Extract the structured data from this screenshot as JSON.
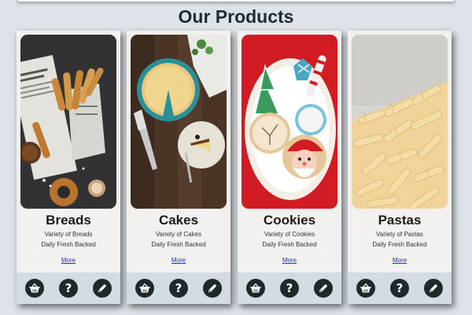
{
  "page": {
    "title": "Our Products"
  },
  "products": [
    {
      "name": "Breads",
      "line1": "Variety of Breads",
      "line2": "Daily Fresh Backed",
      "more_label": "More",
      "image": "churros-and-bread-photo",
      "actions": [
        "basket-icon",
        "help-icon",
        "edit-pencil-icon"
      ]
    },
    {
      "name": "Cakes",
      "line1": "Variety of Cakes",
      "line2": "Daily Fresh Backed",
      "more_label": "More",
      "image": "cheesecake-photo",
      "actions": [
        "basket-icon",
        "help-icon",
        "edit-pencil-icon"
      ]
    },
    {
      "name": "Cookies",
      "line1": "Variety of Cookies",
      "line2": "Daily Fresh Backed",
      "more_label": "More",
      "image": "christmas-cookies-photo",
      "actions": [
        "basket-icon",
        "help-icon",
        "edit-pencil-icon"
      ]
    },
    {
      "name": "Pastas",
      "line1": "Variety of Pastas",
      "line2": "Daily Fresh Backed",
      "more_label": "More",
      "image": "fusilli-pasta-photo",
      "actions": [
        "basket-icon",
        "help-icon",
        "edit-pencil-icon"
      ]
    }
  ],
  "icons": {
    "help_glyph": "?"
  },
  "colors": {
    "background": "#dde3e8",
    "card": "#f3f1ef",
    "footer": "#d5dce1",
    "icon_circle": "#1e2a2a",
    "link": "#1a2fd0"
  }
}
